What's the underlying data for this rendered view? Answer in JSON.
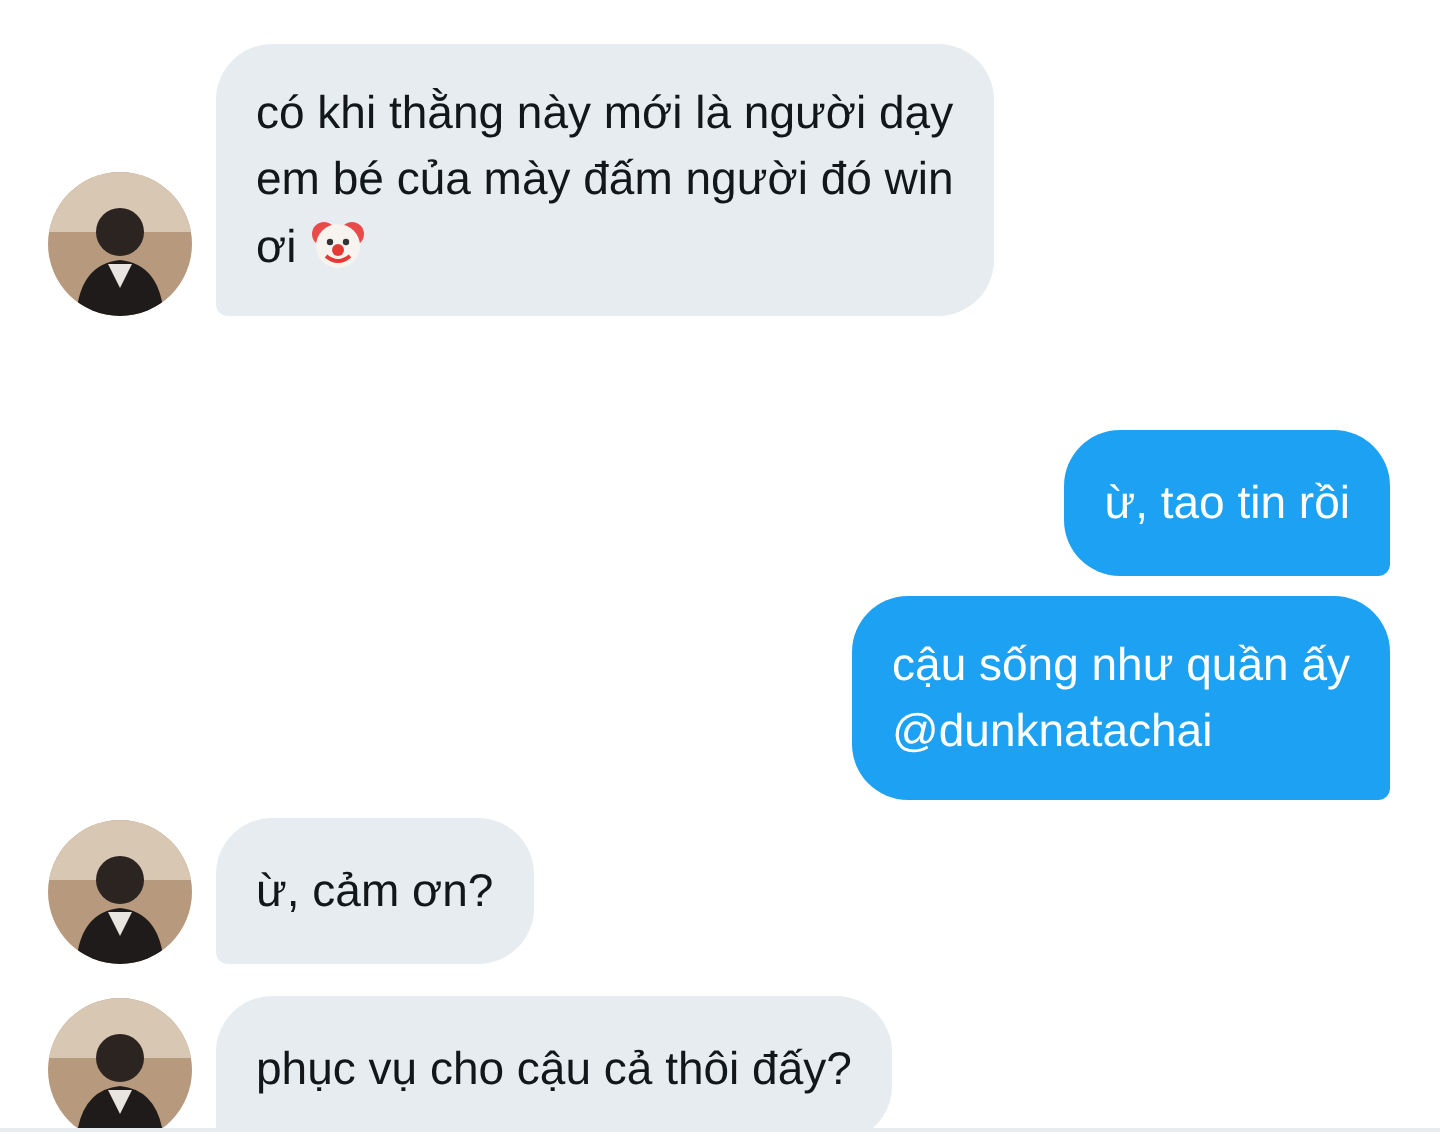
{
  "messages": [
    {
      "kind": "incoming",
      "text": "có khi thằng này mới là người dạy\nem bé của mày đấm người đó win\nơi",
      "trailing_icon": true
    },
    {
      "kind": "outgoing",
      "text": "ừ, tao tin rồi"
    },
    {
      "kind": "outgoing",
      "text": "cậu sống như quần ấy\n@dunknatachai"
    },
    {
      "kind": "incoming",
      "text": "ừ, cảm ơn?"
    },
    {
      "kind": "incoming",
      "text": "phục vụ cho cậu cả thôi đấy?"
    }
  ]
}
